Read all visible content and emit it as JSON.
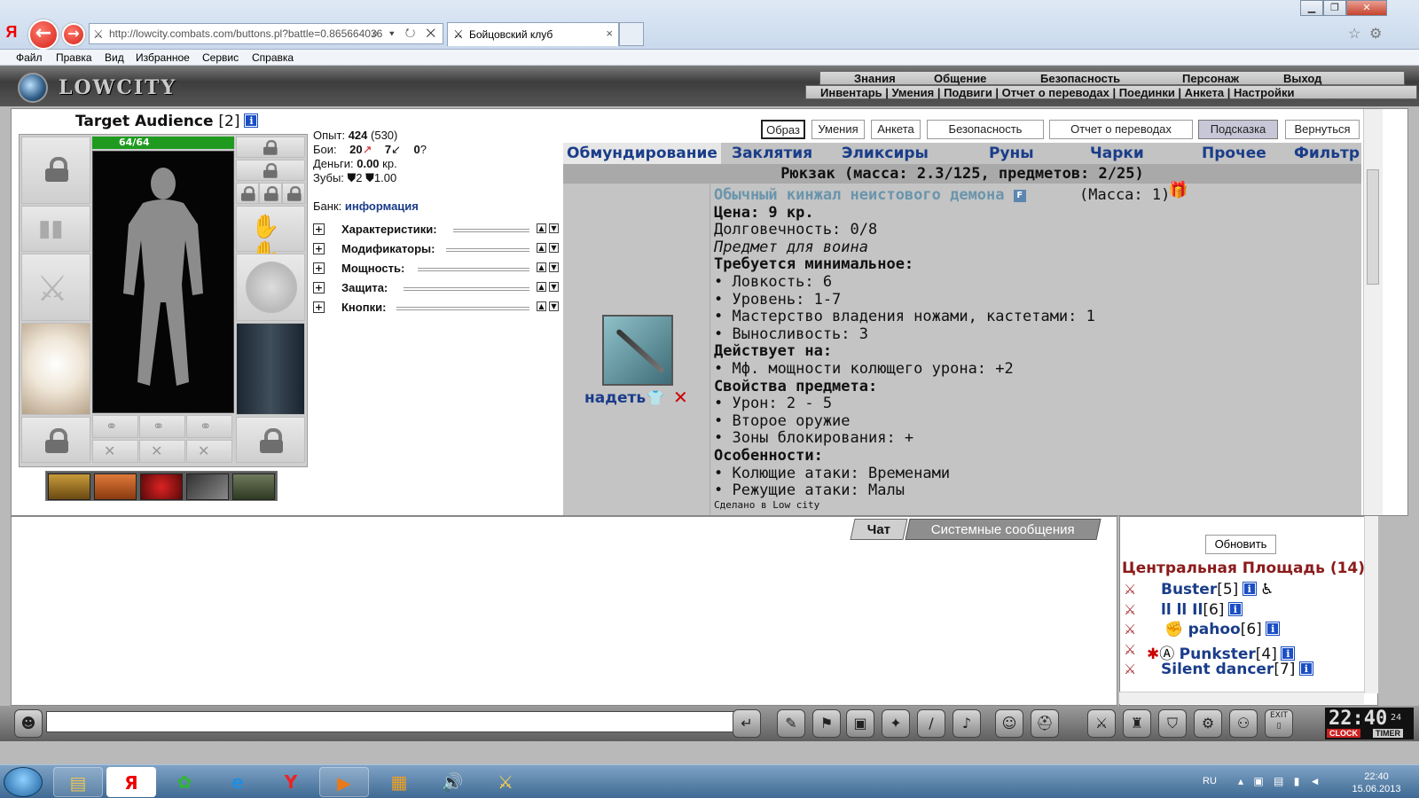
{
  "browser": {
    "url": "http://lowcity.combats.com/buttons.pl?battle=0.865664036",
    "tab_title": "Бойцовский клуб",
    "menu": [
      "Файл",
      "Правка",
      "Вид",
      "Избранное",
      "Сервис",
      "Справка"
    ]
  },
  "game": {
    "logo": "LOWCITY",
    "nav_primary": [
      "Знания",
      "Общение",
      "Безопасность",
      "Персонаж",
      "Выход"
    ],
    "nav_secondary": "Инвентарь | Умения | Подвиги | Отчет о переводах | Поединки | Анкета | Настройки",
    "character": {
      "name": "Target Audience",
      "level": "[2]",
      "info_badge": "i",
      "hp": "64/64",
      "hp_fraction": 1.0
    },
    "stats": {
      "exp_label": "Опыт:",
      "exp_value": "424",
      "exp_next": "(530)",
      "fights_label": "Бои:",
      "wins": "20",
      "losses": "7",
      "draws": "0",
      "money_label": "Деньги:",
      "money_value": "0.00",
      "money_unit": "кр.",
      "teeth_label": "Зубы:",
      "teeth_a": "2",
      "teeth_b": "1.00",
      "bank_label": "Банк:",
      "bank_link": "информация"
    },
    "sections": [
      "Характеристики:",
      "Модификаторы:",
      "Мощность:",
      "Защита:",
      "Кнопки:"
    ],
    "top_buttons": [
      "Образ",
      "Умения",
      "Анкета",
      "Безопасность",
      "Отчет о переводах",
      "Подсказка",
      "Вернуться"
    ],
    "inventory_tabs": [
      "Обмундирование",
      "Заклятия",
      "Эликсиры",
      "Руны",
      "Чарки",
      "Прочее",
      "Фильтр"
    ],
    "backpack_title": "Рюкзак (масса: 2.3/125, предметов: 2/25)",
    "item": {
      "name": "Обычный кинжал неистового демона",
      "flag": "F",
      "mass": "(Масса: 1)",
      "price": "Цена: 9 кр.",
      "durability": "Долговечность: 0/8",
      "for_class": "Предмет для воина",
      "req_title": "Требуется минимальное:",
      "req": [
        "• Ловкость: 6",
        "• Уровень: 1-7",
        "• Мастерство владения ножами, кастетами: 1",
        "• Выносливость: 3"
      ],
      "acts_title": "Действует на:",
      "acts": [
        "• Мф. мощности колющего урона: +2"
      ],
      "props_title": "Свойства предмета:",
      "props": [
        "• Урон: 2 - 5",
        "• Второе оружие",
        "• Зоны блокирования: +"
      ],
      "feat_title": "Особенности:",
      "feats": [
        "• Колющие атаки: Временами",
        "• Режущие атаки: Малы"
      ],
      "footer": "Сделано в Low city",
      "equip_label": "надеть"
    },
    "chat": {
      "tab_chat": "Чат",
      "tab_system": "Системные сообщения"
    },
    "online": {
      "refresh": "Обновить",
      "room": "Центральная Площадь (14)",
      "users": [
        {
          "name": "Buster",
          "level": "[5]"
        },
        {
          "name": "ll ll Il",
          "level": "[6]"
        },
        {
          "name": "pahoo",
          "level": "[6]"
        },
        {
          "name": "Punkster",
          "level": "[4]"
        },
        {
          "name": "Silent dancer",
          "level": "[7]"
        }
      ]
    },
    "clock": {
      "time": "22:40",
      "seconds": "24",
      "label_clock": "CLOCK",
      "label_timer": "TIMER",
      "exit": "EXIT"
    }
  },
  "taskbar": {
    "lang": "RU",
    "time": "22:40",
    "date": "15.06.2013"
  }
}
